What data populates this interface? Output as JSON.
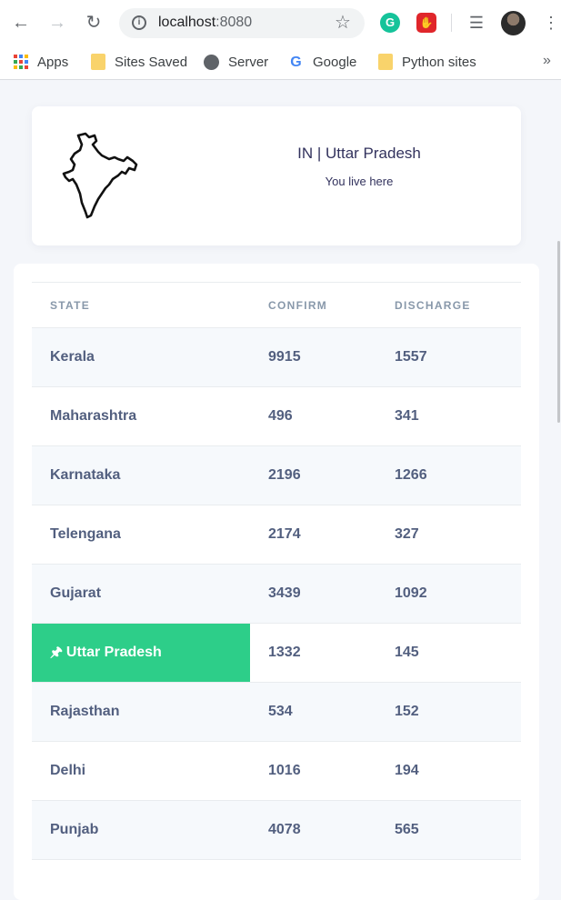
{
  "browser": {
    "url_host": "localhost",
    "url_port": ":8080",
    "bookmarks": [
      {
        "label": "Apps",
        "icon": "apps-grid-icon"
      },
      {
        "label": "Sites Saved",
        "icon": "folder-icon"
      },
      {
        "label": "Server",
        "icon": "globe-icon"
      },
      {
        "label": "Google",
        "icon": "google-icon"
      },
      {
        "label": "Python sites",
        "icon": "folder-icon"
      }
    ],
    "more_label": "»",
    "grammarly_letter": "G"
  },
  "location": {
    "title": "IN | Uttar Pradesh",
    "subtitle": "You live here",
    "map_icon": "india-map-icon"
  },
  "table": {
    "headers": {
      "state": "STATE",
      "confirm": "CONFIRM",
      "discharge": "DISCHARGE"
    },
    "rows": [
      {
        "state": "Kerala",
        "confirm": "9915",
        "discharge": "1557"
      },
      {
        "state": "Maharashtra",
        "confirm": "496",
        "discharge": "341"
      },
      {
        "state": "Karnataka",
        "confirm": "2196",
        "discharge": "1266"
      },
      {
        "state": "Telengana",
        "confirm": "2174",
        "discharge": "327"
      },
      {
        "state": "Gujarat",
        "confirm": "3439",
        "discharge": "1092"
      },
      {
        "state": "Uttar Pradesh",
        "confirm": "1332",
        "discharge": "145",
        "pinned": true
      },
      {
        "state": "Rajasthan",
        "confirm": "534",
        "discharge": "152"
      },
      {
        "state": "Delhi",
        "confirm": "1016",
        "discharge": "194"
      },
      {
        "state": "Punjab",
        "confirm": "4078",
        "discharge": "565"
      }
    ]
  },
  "colors": {
    "accent_green": "#2dce89",
    "text_primary": "#525f7f",
    "header_text": "#8898aa"
  }
}
